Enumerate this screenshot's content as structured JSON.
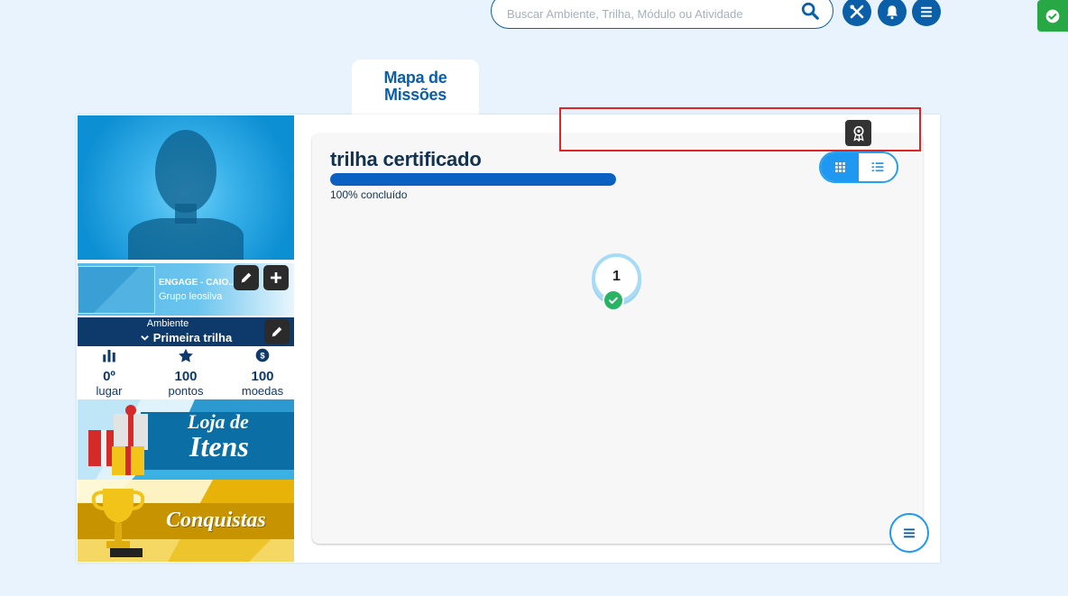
{
  "header": {
    "search": {
      "placeholder": "Buscar Ambiente, Trilha, Módulo ou Atividade",
      "value": ""
    },
    "icons": [
      "search-icon",
      "tools-icon",
      "bell-icon",
      "menu-icon"
    ],
    "status_badge_icon": "check-icon"
  },
  "tab": {
    "label": "Mapa de Missões"
  },
  "profile": {
    "group_name": "ENGAGE - CAIO...",
    "group_sub": "Grupo leosilva",
    "environment_label": "Ambiente",
    "environment_value": "Primeira trilha",
    "stats": [
      {
        "icon": "bar-chart-icon",
        "value": "0º",
        "label": "lugar"
      },
      {
        "icon": "star-icon",
        "value": "100",
        "label": "pontos"
      },
      {
        "icon": "coin-icon",
        "value": "100",
        "label": "moedas"
      }
    ],
    "banners": {
      "loja_line1": "Loja de",
      "loja_line2": "Itens",
      "conquistas": "Conquistas"
    }
  },
  "trail": {
    "title": "trilha certificado",
    "progress_percent": 100,
    "progress_text": "100% concluído",
    "view_modes": [
      "grid-icon",
      "list-icon"
    ],
    "active_view": "grid",
    "node": {
      "number": "1",
      "status": "completed"
    }
  },
  "colors": {
    "brand_blue": "#0b5ea8",
    "accent_blue": "#1e98f0",
    "success_green": "#28b463",
    "highlight_red": "#e02424"
  }
}
